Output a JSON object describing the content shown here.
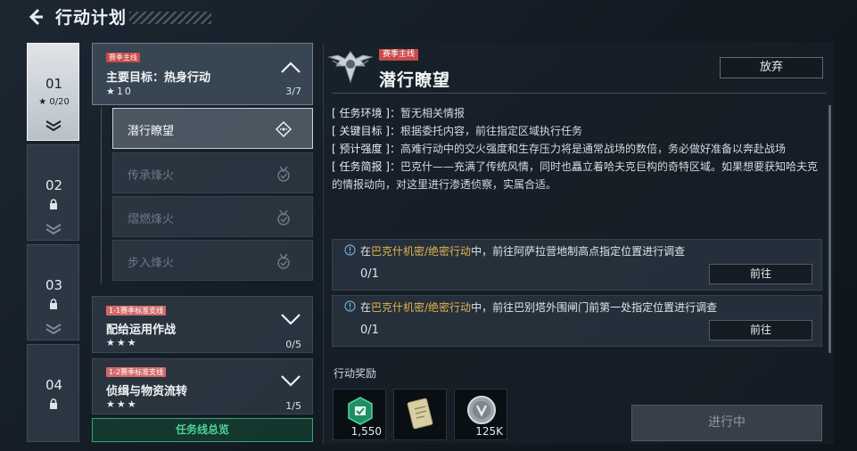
{
  "header": {
    "title": "行动计划"
  },
  "chapters": [
    {
      "num": "01",
      "progress": "0/20",
      "active": true,
      "locked": false
    },
    {
      "num": "02",
      "locked": true
    },
    {
      "num": "03",
      "locked": true
    },
    {
      "num": "04",
      "locked": true
    }
  ],
  "tasks": {
    "main": {
      "tag": "赛季主线",
      "title": "主要目标：热身行动",
      "stars": "★10",
      "count": "3/7"
    },
    "sub_items": [
      "潜行瞭望",
      "传承烽火",
      "熠燃烽火",
      "步入烽火"
    ],
    "side1": {
      "tag": "1-1赛季标准支线",
      "title": "配给运用作战",
      "stars": "★★★",
      "count": "0/5"
    },
    "side2": {
      "tag": "1-2赛季标准支线",
      "title": "侦缉与物资流转",
      "stars": "★★★",
      "count": "1/5"
    },
    "overview_label": "任务线总览"
  },
  "mission": {
    "tag": "赛季主线",
    "title": "潜行瞭望",
    "abandon_label": "放弃",
    "env_key": "[ 任务环境 ]：",
    "env_val": "暂无相关情报",
    "goal_key": "[ 关键目标 ]：",
    "goal_val": "根据委托内容，前往指定区域执行任务",
    "intensity_key": "[ 预计强度 ]：",
    "intensity_val": "高难行动中的交火强度和生存压力将是通常战场的数倍，务必做好准备以奔赴战场",
    "brief_key": "[ 任务简报 ]：",
    "brief_val": "巴克什——充满了传统风情，同时也矗立着哈夫克巨构的奇特区域。如果想要获知哈夫克的情报动向，对这里进行渗透侦察，实属合适。"
  },
  "objectives": [
    {
      "pre": "在",
      "hl": "巴克什机密/绝密行动",
      "post": "中，前往阿萨拉营地制高点指定位置进行调查",
      "progress": "0/1",
      "button": "前往"
    },
    {
      "pre": "在",
      "hl": "巴克什机密/绝密行动",
      "post": "中，前往巴别塔外围闸门前第一处指定位置进行调查",
      "progress": "0/1",
      "button": "前往"
    }
  ],
  "rewards": {
    "label": "行动奖励",
    "items": [
      {
        "icon": "green-badge-icon",
        "value": "1,550"
      },
      {
        "icon": "document-card-icon",
        "value": ""
      },
      {
        "icon": "silver-coin-icon",
        "value": "125K"
      }
    ]
  },
  "action_button": "进行中",
  "colors": {
    "accent_green": "#49d39a",
    "highlight_gold": "#e2b44e",
    "tag_red": "#c84a4a"
  }
}
